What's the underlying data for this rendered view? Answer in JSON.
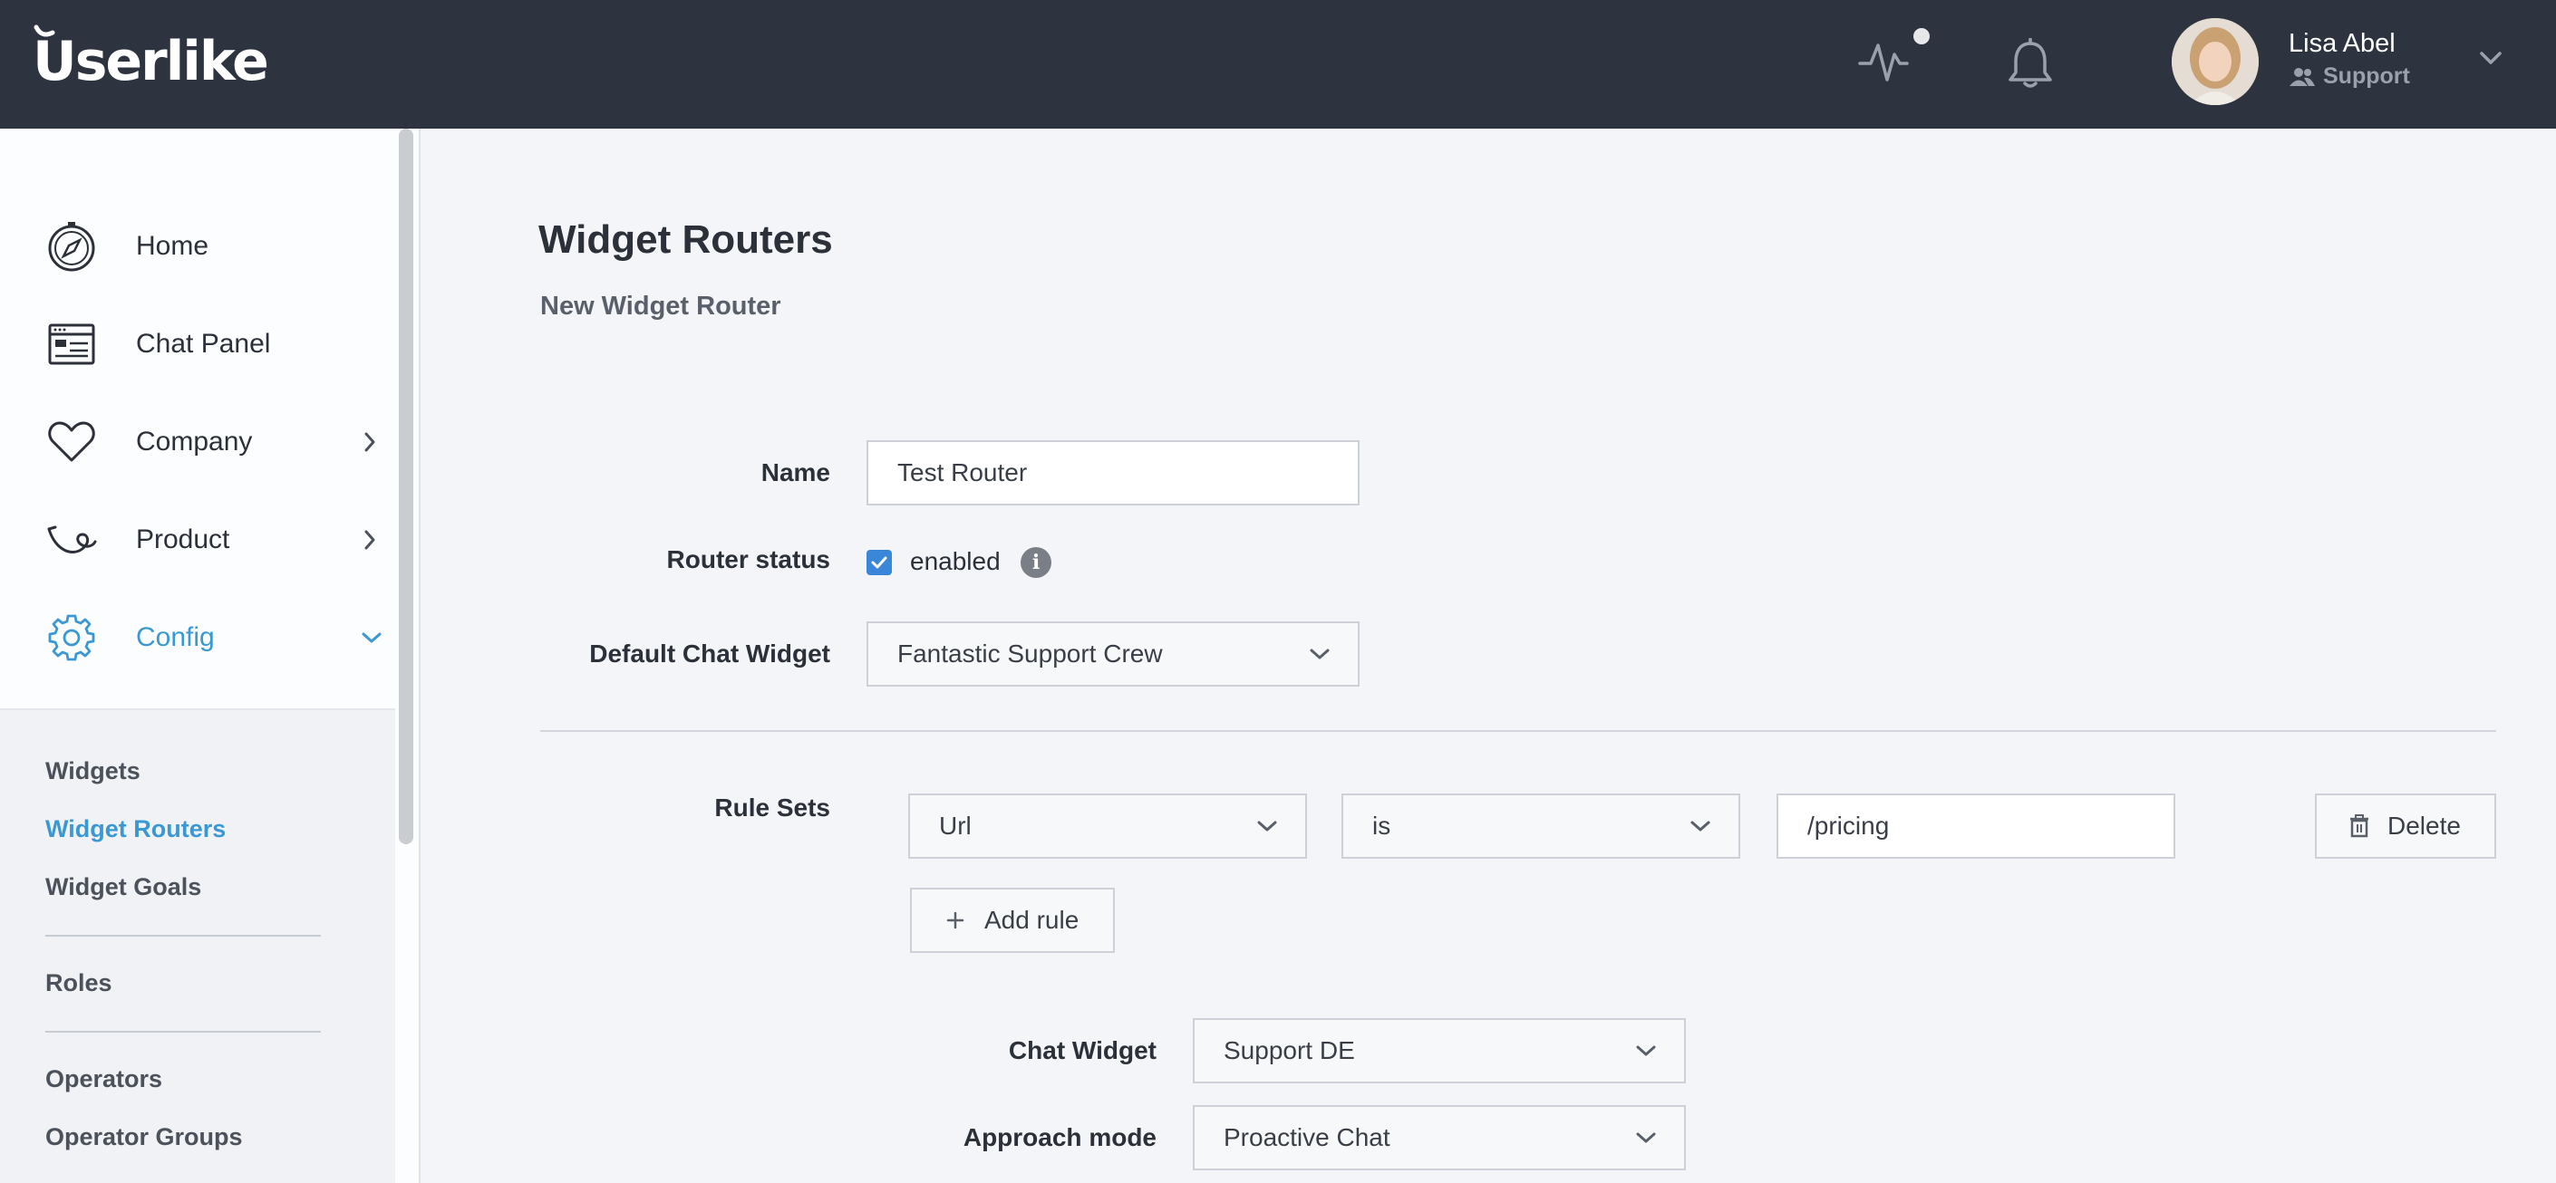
{
  "header": {
    "brand": "Userlike",
    "user_name": "Lisa Abel",
    "user_role": "Support",
    "icons": [
      "activity-icon",
      "bell-icon",
      "chevron-down-icon"
    ],
    "colors": {
      "bar_bg": "#2d3440",
      "accent": "#3a98d3",
      "checkbox": "#3a86d8"
    }
  },
  "sidebar": {
    "items": [
      {
        "label": "Home",
        "icon": "compass-icon"
      },
      {
        "label": "Chat Panel",
        "icon": "chat-panel-icon"
      },
      {
        "label": "Company",
        "icon": "heart-icon"
      },
      {
        "label": "Product",
        "icon": "product-icon"
      },
      {
        "label": "Config",
        "icon": "gear-icon"
      }
    ],
    "sub_items": [
      "Widgets",
      "Widget Routers",
      "Widget Goals",
      "Roles",
      "Operators",
      "Operator Groups"
    ]
  },
  "main": {
    "title": "Widget Routers",
    "subtitle": "New Widget Router",
    "form": {
      "name_label": "Name",
      "name_value": "Test Router",
      "status_label": "Router status",
      "status_option": "enabled",
      "status_checked": true,
      "default_widget_label": "Default Chat Widget",
      "default_widget_value": "Fantastic Support Crew",
      "rule_sets_label": "Rule Sets",
      "rule_field": "Url",
      "rule_operator": "is",
      "rule_value": "/pricing",
      "delete_label": "Delete",
      "add_rule_label": "Add rule",
      "chat_widget_label": "Chat Widget",
      "chat_widget_value": "Support DE",
      "approach_label": "Approach mode",
      "approach_value": "Proactive Chat"
    }
  }
}
